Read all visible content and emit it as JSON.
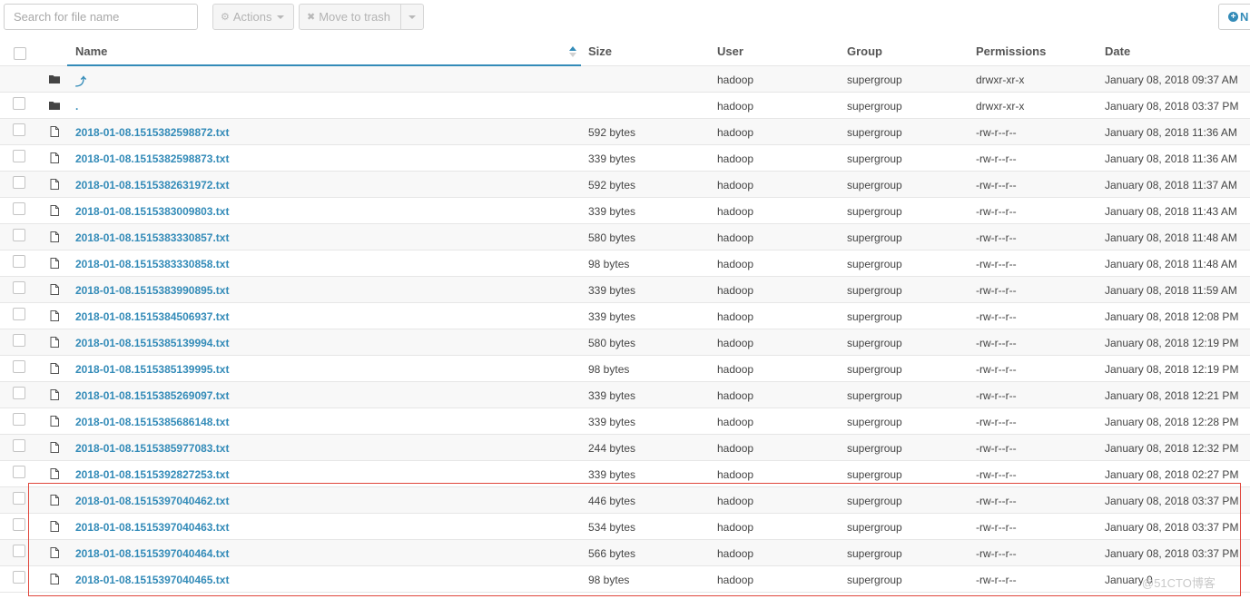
{
  "toolbar": {
    "search_placeholder": "Search for file name",
    "actions_label": "Actions",
    "trash_label": "Move to trash",
    "new_label": "N"
  },
  "columns": [
    "Name",
    "Size",
    "User",
    "Group",
    "Permissions",
    "Date"
  ],
  "rows": [
    {
      "type": "folder",
      "name": "⤴",
      "size": "",
      "user": "hadoop",
      "group": "supergroup",
      "perm": "drwxr-xr-x",
      "date": "January 08, 2018 09:37 AM"
    },
    {
      "type": "folder",
      "name": ".",
      "size": "",
      "user": "hadoop",
      "group": "supergroup",
      "perm": "drwxr-xr-x",
      "date": "January 08, 2018 03:37 PM"
    },
    {
      "type": "file",
      "name": "2018-01-08.1515382598872.txt",
      "size": "592 bytes",
      "user": "hadoop",
      "group": "supergroup",
      "perm": "-rw-r--r--",
      "date": "January 08, 2018 11:36 AM"
    },
    {
      "type": "file",
      "name": "2018-01-08.1515382598873.txt",
      "size": "339 bytes",
      "user": "hadoop",
      "group": "supergroup",
      "perm": "-rw-r--r--",
      "date": "January 08, 2018 11:36 AM"
    },
    {
      "type": "file",
      "name": "2018-01-08.1515382631972.txt",
      "size": "592 bytes",
      "user": "hadoop",
      "group": "supergroup",
      "perm": "-rw-r--r--",
      "date": "January 08, 2018 11:37 AM"
    },
    {
      "type": "file",
      "name": "2018-01-08.1515383009803.txt",
      "size": "339 bytes",
      "user": "hadoop",
      "group": "supergroup",
      "perm": "-rw-r--r--",
      "date": "January 08, 2018 11:43 AM"
    },
    {
      "type": "file",
      "name": "2018-01-08.1515383330857.txt",
      "size": "580 bytes",
      "user": "hadoop",
      "group": "supergroup",
      "perm": "-rw-r--r--",
      "date": "January 08, 2018 11:48 AM"
    },
    {
      "type": "file",
      "name": "2018-01-08.1515383330858.txt",
      "size": "98 bytes",
      "user": "hadoop",
      "group": "supergroup",
      "perm": "-rw-r--r--",
      "date": "January 08, 2018 11:48 AM"
    },
    {
      "type": "file",
      "name": "2018-01-08.1515383990895.txt",
      "size": "339 bytes",
      "user": "hadoop",
      "group": "supergroup",
      "perm": "-rw-r--r--",
      "date": "January 08, 2018 11:59 AM"
    },
    {
      "type": "file",
      "name": "2018-01-08.1515384506937.txt",
      "size": "339 bytes",
      "user": "hadoop",
      "group": "supergroup",
      "perm": "-rw-r--r--",
      "date": "January 08, 2018 12:08 PM"
    },
    {
      "type": "file",
      "name": "2018-01-08.1515385139994.txt",
      "size": "580 bytes",
      "user": "hadoop",
      "group": "supergroup",
      "perm": "-rw-r--r--",
      "date": "January 08, 2018 12:19 PM"
    },
    {
      "type": "file",
      "name": "2018-01-08.1515385139995.txt",
      "size": "98 bytes",
      "user": "hadoop",
      "group": "supergroup",
      "perm": "-rw-r--r--",
      "date": "January 08, 2018 12:19 PM"
    },
    {
      "type": "file",
      "name": "2018-01-08.1515385269097.txt",
      "size": "339 bytes",
      "user": "hadoop",
      "group": "supergroup",
      "perm": "-rw-r--r--",
      "date": "January 08, 2018 12:21 PM"
    },
    {
      "type": "file",
      "name": "2018-01-08.1515385686148.txt",
      "size": "339 bytes",
      "user": "hadoop",
      "group": "supergroup",
      "perm": "-rw-r--r--",
      "date": "January 08, 2018 12:28 PM"
    },
    {
      "type": "file",
      "name": "2018-01-08.1515385977083.txt",
      "size": "244 bytes",
      "user": "hadoop",
      "group": "supergroup",
      "perm": "-rw-r--r--",
      "date": "January 08, 2018 12:32 PM"
    },
    {
      "type": "file",
      "name": "2018-01-08.1515392827253.txt",
      "size": "339 bytes",
      "user": "hadoop",
      "group": "supergroup",
      "perm": "-rw-r--r--",
      "date": "January 08, 2018 02:27 PM"
    },
    {
      "type": "file",
      "name": "2018-01-08.1515397040462.txt",
      "size": "446 bytes",
      "user": "hadoop",
      "group": "supergroup",
      "perm": "-rw-r--r--",
      "date": "January 08, 2018 03:37 PM"
    },
    {
      "type": "file",
      "name": "2018-01-08.1515397040463.txt",
      "size": "534 bytes",
      "user": "hadoop",
      "group": "supergroup",
      "perm": "-rw-r--r--",
      "date": "January 08, 2018 03:37 PM"
    },
    {
      "type": "file",
      "name": "2018-01-08.1515397040464.txt",
      "size": "566 bytes",
      "user": "hadoop",
      "group": "supergroup",
      "perm": "-rw-r--r--",
      "date": "January 08, 2018 03:37 PM"
    },
    {
      "type": "file",
      "name": "2018-01-08.1515397040465.txt",
      "size": "98 bytes",
      "user": "hadoop",
      "group": "supergroup",
      "perm": "-rw-r--r--",
      "date": "January 0"
    }
  ],
  "watermark": "@51CTO博客",
  "colors": {
    "link": "#338bb8",
    "highlight_border": "#e0463c"
  },
  "icons": {
    "folder": "folder-icon",
    "file": "file-icon",
    "actions": "gear-icon",
    "trash": "times-icon",
    "new": "plus-circle-icon"
  }
}
